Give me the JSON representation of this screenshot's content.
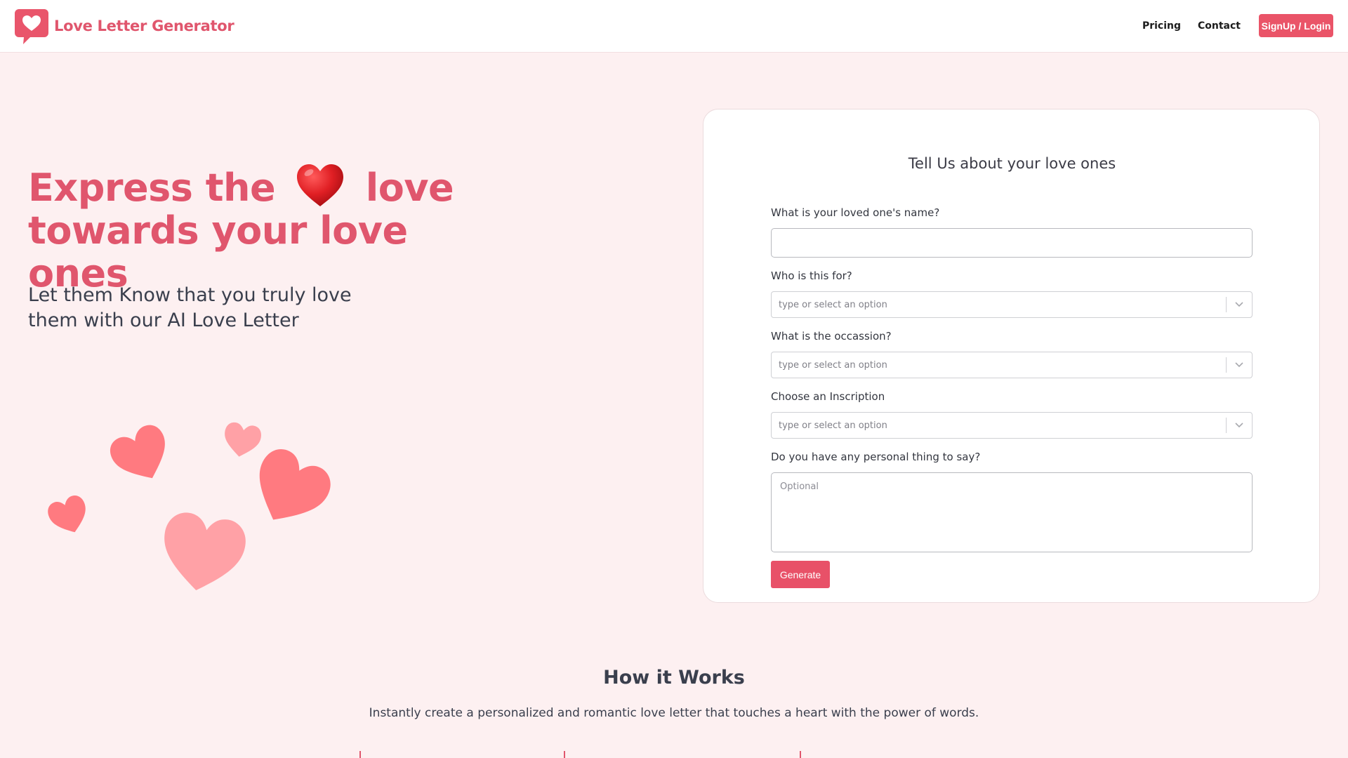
{
  "header": {
    "logo_text": "Love Letter Generator",
    "logo_icon": "heart-chat-bubble-icon",
    "nav": {
      "pricing": "Pricing",
      "contact": "Contact",
      "signup": "SignUp / Login"
    }
  },
  "hero": {
    "title_part1": "Express the",
    "title_part2": "love",
    "title_part3": "towards your love ones",
    "heart_icon": "red-heart-emoji-icon",
    "subtitle": "Let them Know that you truly love them with our AI Love Letter"
  },
  "form": {
    "title": "Tell Us about your love ones",
    "fields": [
      {
        "label": "What is your loved one's name?",
        "value": ""
      },
      {
        "label": "Who is this for?",
        "placeholder": "type or select an option"
      },
      {
        "label": "What is the occassion?",
        "placeholder": "type or select an option"
      },
      {
        "label": "Choose an Inscription",
        "placeholder": "type or select an option"
      },
      {
        "label": "Do you have any personal thing to say?",
        "placeholder": "Optional"
      }
    ],
    "submit": "Generate"
  },
  "how_it_works": {
    "title": "How it Works",
    "subtitle": "Instantly create a personalized and romantic love letter that touches a heart with the power of words."
  },
  "colors": {
    "brand": "#e0566d",
    "button": "#ea5468",
    "page_bg": "#fdf0f1",
    "heart_light": "#ffa1a6",
    "heart_mid": "#ff7a80"
  }
}
